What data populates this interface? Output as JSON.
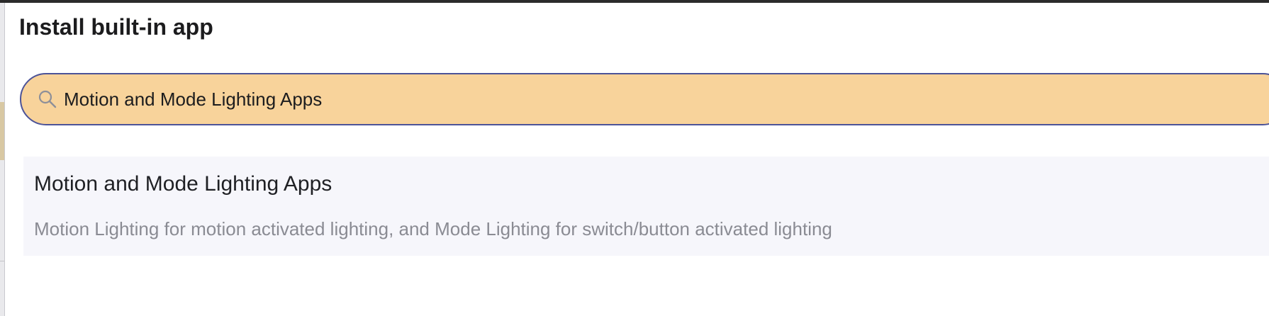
{
  "dialog": {
    "title": "Install built-in app"
  },
  "search": {
    "value": "Motion and Mode Lighting Apps",
    "icon": "search-icon"
  },
  "results": [
    {
      "title": "Motion and Mode Lighting Apps",
      "description": "Motion Lighting for motion activated lighting, and Mode Lighting for switch/button activated lighting"
    }
  ],
  "colors": {
    "search_bg": "#f8d39b",
    "search_border": "#4c5398",
    "result_bg": "#f6f6fb",
    "description_text": "#8a8b93"
  }
}
